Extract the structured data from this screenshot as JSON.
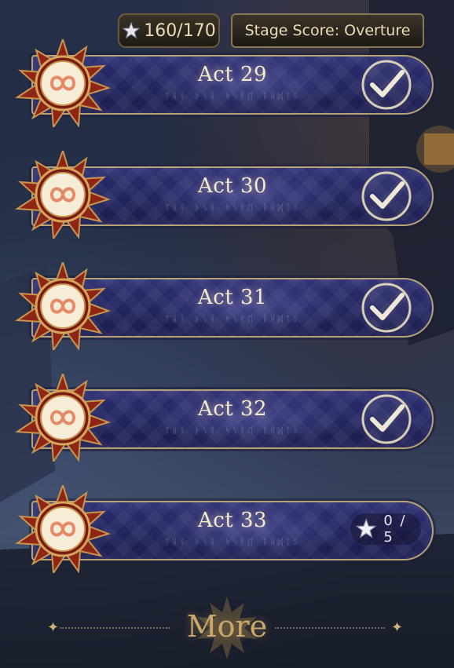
{
  "header": {
    "star_total": "160/170",
    "stage_score_label": "Stage Score: Overture"
  },
  "acts": [
    {
      "title": "Act 29",
      "subtitle": "ᛉᚺᚾ ᚦᛊᚺ ᛋᛊᛒᛖ ᚱᚺᛞᛏᛟ",
      "status": "completed",
      "icon": "checkmark-icon"
    },
    {
      "title": "Act 30",
      "subtitle": "ᛉᚺᚾ ᚦᛊᚺ ᛋᛊᛒᛖ ᚱᚺᛞᛏᛟ",
      "status": "completed",
      "icon": "checkmark-icon"
    },
    {
      "title": "Act 31",
      "subtitle": "ᛉᚺᚾ ᚦᛊᚺ ᛋᛊᛒᛖ ᚱᚺᛞᛏᛟ",
      "status": "completed",
      "icon": "checkmark-icon"
    },
    {
      "title": "Act 32",
      "subtitle": "ᛉᚺᚾ ᚦᛊᚺ ᛋᛊᛒᛖ ᚱᚺᛞᛏᛟ",
      "status": "completed",
      "icon": "checkmark-icon"
    },
    {
      "title": "Act 33",
      "subtitle": "ᛉᚺᚾ ᚦᛊᚺ ᛋᛊᛒᛖ ᚱᚺᛞᛏᛟ",
      "status": "in-progress",
      "progress": "0 / 5",
      "icon": "star-icon"
    }
  ],
  "footer": {
    "more_label": "More"
  },
  "colors": {
    "plaque": "#232560",
    "gold_text": "#e9dcb6",
    "sun_emblem": "#9b2a1c"
  }
}
